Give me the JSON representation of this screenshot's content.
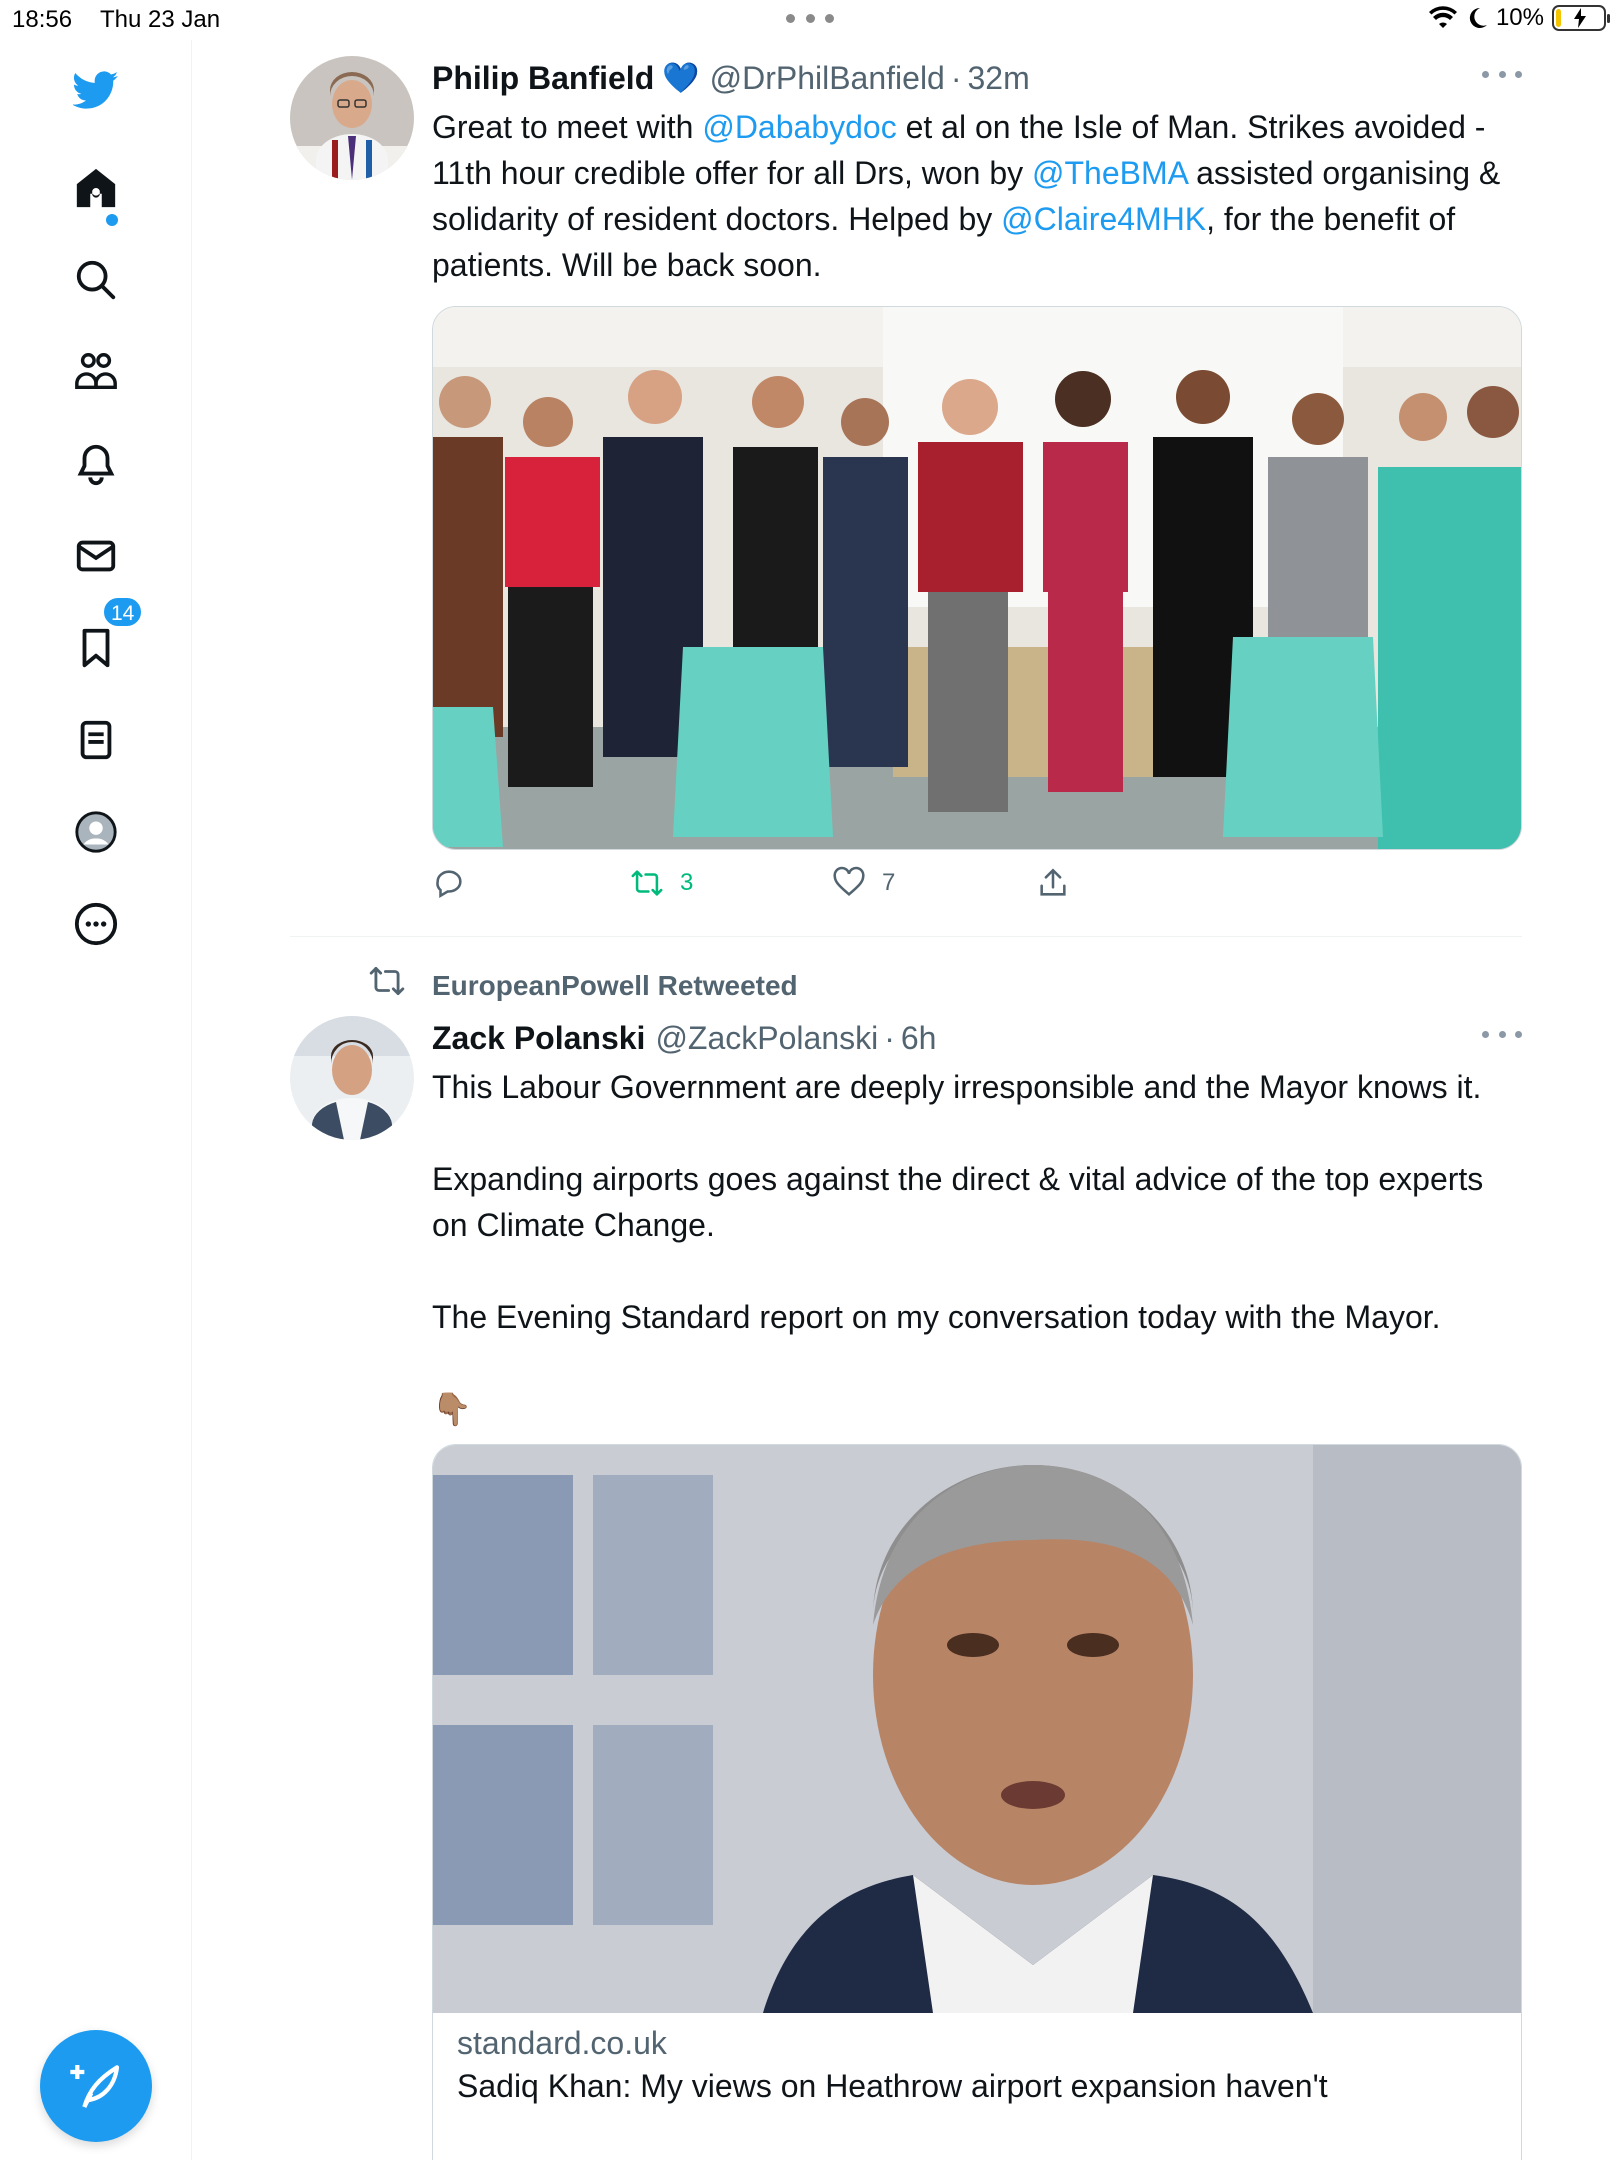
{
  "status_bar": {
    "time": "18:56",
    "date": "Thu 23 Jan",
    "battery": "10%",
    "battery_level": 0.1
  },
  "sidebar": {
    "icons": [
      "twitter-logo-icon",
      "home-icon",
      "search-icon",
      "communities-icon",
      "notifications-icon",
      "messages-icon",
      "bookmarks-icon",
      "lists-icon",
      "profile-icon",
      "more-icon"
    ],
    "notification_count": "14",
    "compose_icon": "compose-tweet-icon"
  },
  "tweets": [
    {
      "name": "Philip Banfield",
      "emoji": "💙",
      "handle": "@DrPhilBanfield",
      "time": "32m",
      "text": {
        "t1": "Great to meet with ",
        "m1": "@Dababydoc",
        "t2": " et al on the Isle of Man. Strikes avoided - 11th hour credible offer for all Drs, won by ",
        "m2": "@TheBMA",
        "t3": " assisted organising & solidarity of resident doctors. Helped by ",
        "m3": "@Claire4MHK",
        "t4": ", for the benefit of patients. Will be back soon."
      },
      "replies": "",
      "retweets": "3",
      "likes": "7"
    },
    {
      "retweeted_by": "EuropeanPowell Retweeted",
      "name": "Zack Polanski",
      "handle": "@ZackPolanski",
      "time": "6h",
      "text": "This Labour Government are deeply irresponsible and the Mayor knows it.\n\nExpanding airports goes against the direct & vital advice of the top experts on Climate Change.\n\nThe Evening Standard report on my conversation today with the Mayor.\n\n👇🏽",
      "card": {
        "domain": "standard.co.uk",
        "title": "Sadiq Khan: My views on Heathrow airport expansion haven't"
      }
    }
  ],
  "colors": {
    "accent": "#1d9bf0",
    "retweet_green": "#00ba7c",
    "secondary_text": "#536471"
  }
}
